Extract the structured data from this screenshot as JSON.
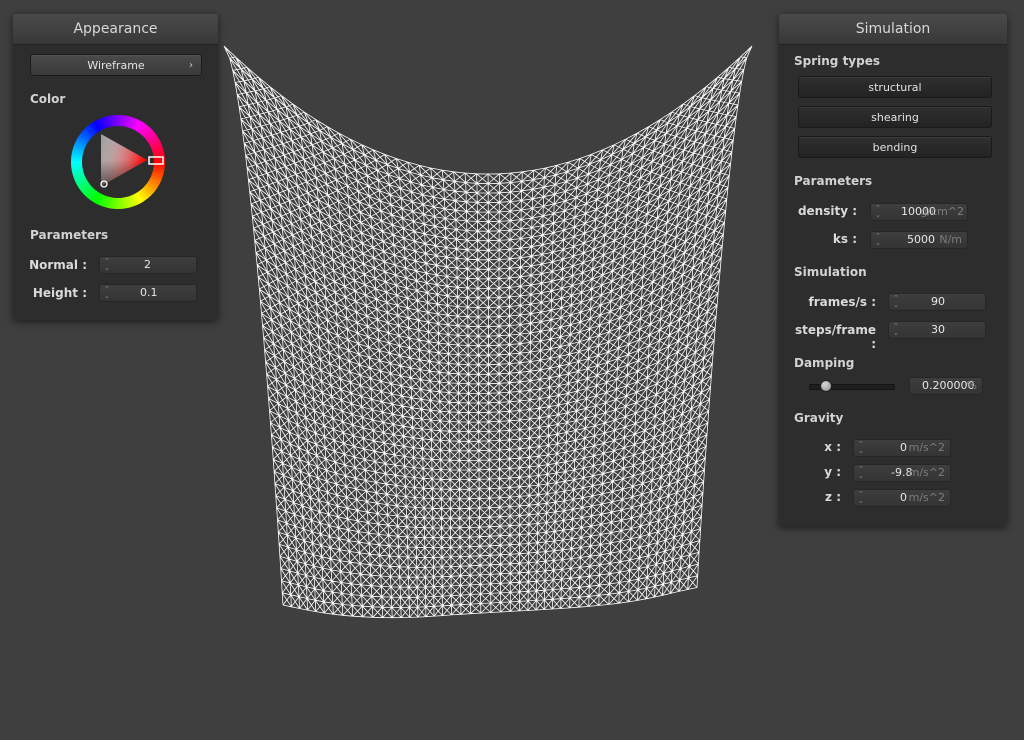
{
  "appearance": {
    "title": "Appearance",
    "render_mode": "Wireframe",
    "color_label": "Color",
    "color_value": "#ff0000",
    "parameters_label": "Parameters",
    "normal_label": "Normal :",
    "normal_value": "2",
    "height_label": "Height :",
    "height_value": "0.1"
  },
  "simulation": {
    "title": "Simulation",
    "spring_types_label": "Spring types",
    "spring_buttons": [
      "structural",
      "shearing",
      "bending"
    ],
    "parameters_label": "Parameters",
    "density_label": "density :",
    "density_value": "10000",
    "density_unit": "g/cm^2",
    "ks_label": "ks :",
    "ks_value": "5000",
    "ks_unit": "N/m",
    "sim_label": "Simulation",
    "fps_label": "frames/s :",
    "fps_value": "90",
    "steps_label": "steps/frame :",
    "steps_value": "30",
    "damping_label": "Damping",
    "damping_value": "0.200000",
    "damping_unit": "%",
    "damping_fraction": 0.2,
    "gravity_label": "Gravity",
    "gx_label": "x :",
    "gx_value": "0",
    "gy_label": "y :",
    "gy_value": "-9.8",
    "gz_label": "z :",
    "gz_value": "0",
    "gravity_unit": "m/s^2"
  },
  "viewport": {
    "mesh_color": "#ffffff",
    "background": "#3f3f3f"
  }
}
